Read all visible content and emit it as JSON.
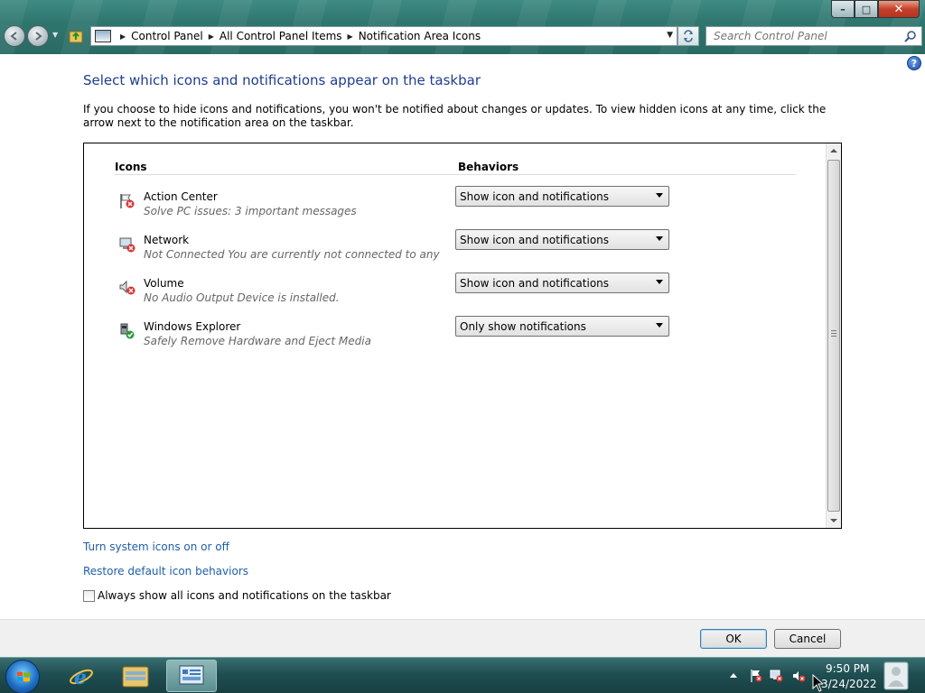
{
  "window": {
    "min_label": "–",
    "max_label": "□",
    "close_label": "✕"
  },
  "address": {
    "crumbs": [
      "Control Panel",
      "All Control Panel Items",
      "Notification Area Icons"
    ]
  },
  "search": {
    "placeholder": "Search Control Panel"
  },
  "page": {
    "help_label": "?",
    "title": "Select which icons and notifications appear on the taskbar",
    "description": "If you choose to hide icons and notifications, you won't be notified about changes or updates. To view hidden icons at any time, click the arrow next to the notification area on the taskbar."
  },
  "table": {
    "col_icons": "Icons",
    "col_behaviors": "Behaviors",
    "rows": [
      {
        "icon": "action-center-flag-icon",
        "name": "Action Center",
        "description": "Solve PC issues: 3 important messages",
        "behavior": "Show icon and notifications"
      },
      {
        "icon": "network-icon",
        "name": "Network",
        "description": "Not Connected You are currently not connected to any netwo...",
        "behavior": "Show icon and notifications"
      },
      {
        "icon": "volume-icon",
        "name": "Volume",
        "description": "No Audio Output Device is installed.",
        "behavior": "Show icon and notifications"
      },
      {
        "icon": "safely-remove-hardware-icon",
        "name": "Windows Explorer",
        "description": "Safely Remove Hardware and Eject Media",
        "behavior": "Only show notifications"
      }
    ]
  },
  "links": {
    "system_icons": "Turn system icons on or off",
    "restore_defaults": "Restore default icon behaviors"
  },
  "always_show": {
    "label": "Always show all icons and notifications on the taskbar",
    "checked": false
  },
  "buttons": {
    "ok": "OK",
    "cancel": "Cancel"
  },
  "taskbar": {
    "time": "9:50 PM",
    "date": "3/24/2022"
  },
  "colors": {
    "title_blue": "#1e3d8f",
    "link_blue": "#1f5fa8",
    "taskbar": "#1f4f52"
  }
}
